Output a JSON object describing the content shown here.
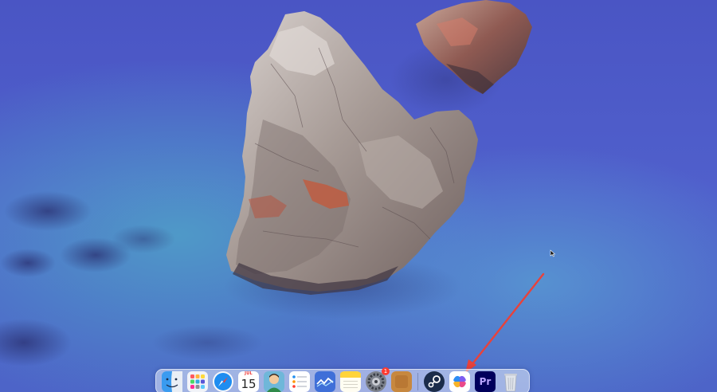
{
  "desktop": {
    "wallpaper": "sea-rock-wallpaper",
    "colors": {
      "water": "#4f5fc9",
      "deep": "#3a3f9e",
      "rock": "#a89a94",
      "rock_red": "#b4513c",
      "annotation": "#e8423b"
    }
  },
  "dock": {
    "items": [
      {
        "id": "finder",
        "icon": "finder-icon"
      },
      {
        "id": "launchpad",
        "icon": "launchpad-icon"
      },
      {
        "id": "safari",
        "icon": "safari-icon"
      },
      {
        "id": "calendar",
        "icon": "calendar-icon",
        "month": "JUL",
        "day": "15"
      },
      {
        "id": "user-app",
        "icon": "avatar-app-icon"
      },
      {
        "id": "reminders",
        "icon": "reminders-icon"
      },
      {
        "id": "stocks",
        "icon": "stocks-icon"
      },
      {
        "id": "notes",
        "icon": "notes-icon"
      },
      {
        "id": "settings",
        "icon": "settings-icon",
        "badge": "1"
      },
      {
        "id": "app-orange",
        "icon": "orange-app-icon"
      },
      {
        "id": "steam",
        "icon": "steam-icon"
      },
      {
        "id": "copilot",
        "icon": "copilot-icon"
      },
      {
        "id": "premiere",
        "icon": "premiere-pro-icon",
        "label": "Pr"
      },
      {
        "id": "trash",
        "icon": "trash-icon"
      }
    ]
  },
  "annotation": {
    "type": "arrow",
    "points_to": "copilot"
  }
}
